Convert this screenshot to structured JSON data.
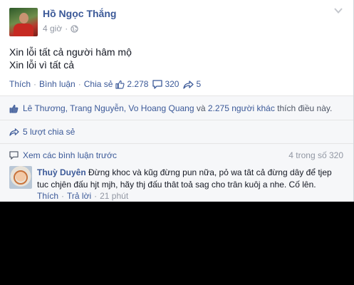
{
  "post": {
    "author": "Hồ Ngọc Thắng",
    "time": "4 giờ",
    "meta_separator": "·",
    "message_lines": [
      "Xin lỗi tất cả người hâm mộ",
      "Xin lỗi vì tất cả"
    ],
    "actions": {
      "like": "Thích",
      "comment": "Bình luận",
      "share": "Chia sẻ",
      "separator": "·",
      "like_count": "2.278",
      "comment_count": "320",
      "share_count": "5"
    }
  },
  "likes_summary": {
    "names": "Lê Thương, Trang Nguyễn, Vo Hoang Quang",
    "and_text": " và ",
    "others_link": "2.275 người khác",
    "suffix": " thích điều này."
  },
  "shares_summary": {
    "text": "5 lượt chia sẻ"
  },
  "comments": {
    "view_previous": "Xem các bình luận trước",
    "count_text": "4 trong số 320",
    "items": [
      {
        "author": "Thuỳ Duyên",
        "text": " Đừng khoc và kũg đừng pun nữa, pỏ wa tât cả đừng dây để tjep tuc chjên đấu hjt mjh, hãy thj đấu thât toả sag cho trân kuôj a nhe. Cố lên.",
        "like": "Thích",
        "reply": "Trả lời",
        "time": "21 phút",
        "separator": "·"
      }
    ]
  },
  "colors": {
    "link": "#3b5998",
    "muted": "#9197a3",
    "text": "#141823",
    "backdrop": "#000000"
  }
}
